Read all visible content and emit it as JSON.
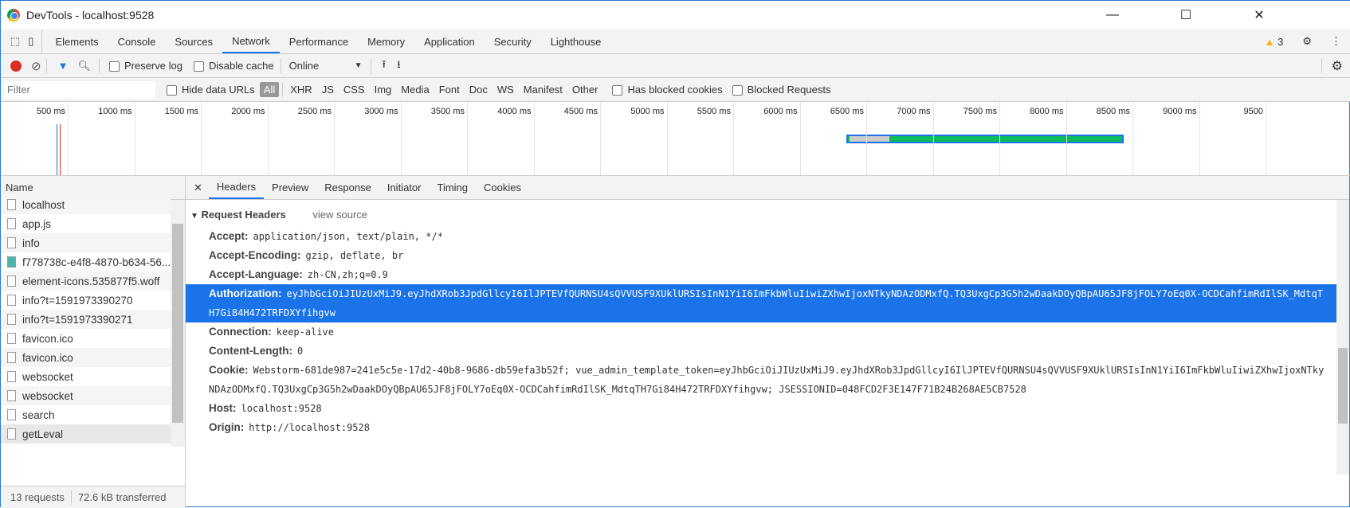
{
  "window": {
    "title": "DevTools - localhost:9528",
    "minimize": "—",
    "maximize": "☐",
    "close": "✕"
  },
  "tabs": [
    "Elements",
    "Console",
    "Sources",
    "Network",
    "Performance",
    "Memory",
    "Application",
    "Security",
    "Lighthouse"
  ],
  "active_tab": "Network",
  "warnings": {
    "count": "3"
  },
  "toolbar": {
    "preserve_log": "Preserve log",
    "disable_cache": "Disable cache",
    "throttle": "Online"
  },
  "filter": {
    "placeholder": "Filter",
    "hide_data_urls": "Hide data URLs",
    "types": [
      "All",
      "XHR",
      "JS",
      "CSS",
      "Img",
      "Media",
      "Font",
      "Doc",
      "WS",
      "Manifest",
      "Other"
    ],
    "has_blocked_cookies": "Has blocked cookies",
    "blocked_requests": "Blocked Requests"
  },
  "timeline": {
    "ticks": [
      "500 ms",
      "1000 ms",
      "1500 ms",
      "2000 ms",
      "2500 ms",
      "3000 ms",
      "3500 ms",
      "4000 ms",
      "4500 ms",
      "5000 ms",
      "5500 ms",
      "6000 ms",
      "6500 ms",
      "7000 ms",
      "7500 ms",
      "8000 ms",
      "8500 ms",
      "9000 ms",
      "9500"
    ]
  },
  "requests": {
    "header": "Name",
    "items": [
      "localhost",
      "app.js",
      "info",
      "f778738c-e4f8-4870-b634-56...",
      "element-icons.535877f5.woff",
      "info?t=1591973390270",
      "info?t=1591973390271",
      "favicon.ico",
      "favicon.ico",
      "websocket",
      "websocket",
      "search",
      "getLeval"
    ],
    "selected": "getLeval"
  },
  "status": {
    "requests": "13 requests",
    "transferred": "72.6 kB transferred"
  },
  "details": {
    "tabs": [
      "Headers",
      "Preview",
      "Response",
      "Initiator",
      "Timing",
      "Cookies"
    ],
    "active": "Headers",
    "section": "Request Headers",
    "view_source": "view source",
    "headers": [
      {
        "name": "Accept:",
        "value": "application/json, text/plain, */*"
      },
      {
        "name": "Accept-Encoding:",
        "value": "gzip, deflate, br"
      },
      {
        "name": "Accept-Language:",
        "value": "zh-CN,zh;q=0.9"
      },
      {
        "name": "Authorization:",
        "value": "eyJhbGciOiJIUzUxMiJ9.eyJhdXRob3JpdGllcyI6IlJPTEVfQURNSU4sQVVUSF9XUklURSIsInN1YiI6ImFkbWluIiwiZXhwIjoxNTkyNDAzODMxfQ.TQ3UxgCp3G5h2wDaakDOyQBpAU65JF8jFOLY7oEq0X-OCDCahfimRdIlSK_MdtqTH7Gi84H472TRFDXYfihgvw"
      },
      {
        "name": "Connection:",
        "value": "keep-alive"
      },
      {
        "name": "Content-Length:",
        "value": "0"
      },
      {
        "name": "Cookie:",
        "value": "Webstorm-681de987=241e5c5e-17d2-40b8-9686-db59efa3b52f; vue_admin_template_token=eyJhbGciOiJIUzUxMiJ9.eyJhdXRob3JpdGllcyI6IlJPTEVfQURNSU4sQVVUSF9XUklURSIsInN1YiI6ImFkbWluIiwiZXhwIjoxNTkyNDAzODMxfQ.TQ3UxgCp3G5h2wDaakDOyQBpAU65JF8jFOLY7oEq0X-OCDCahfimRdIlSK_MdtqTH7Gi84H472TRFDXYfihgvw; JSESSIONID=048FCD2F3E147F71B24B268AE5CB7528"
      },
      {
        "name": "Host:",
        "value": "localhost:9528"
      },
      {
        "name": "Origin:",
        "value": "http://localhost:9528"
      }
    ],
    "selected_header": "Authorization:"
  },
  "colors": {
    "accent": "#1a73e8",
    "record": "#d93025",
    "waterfall_green": "#0cbc5a"
  }
}
